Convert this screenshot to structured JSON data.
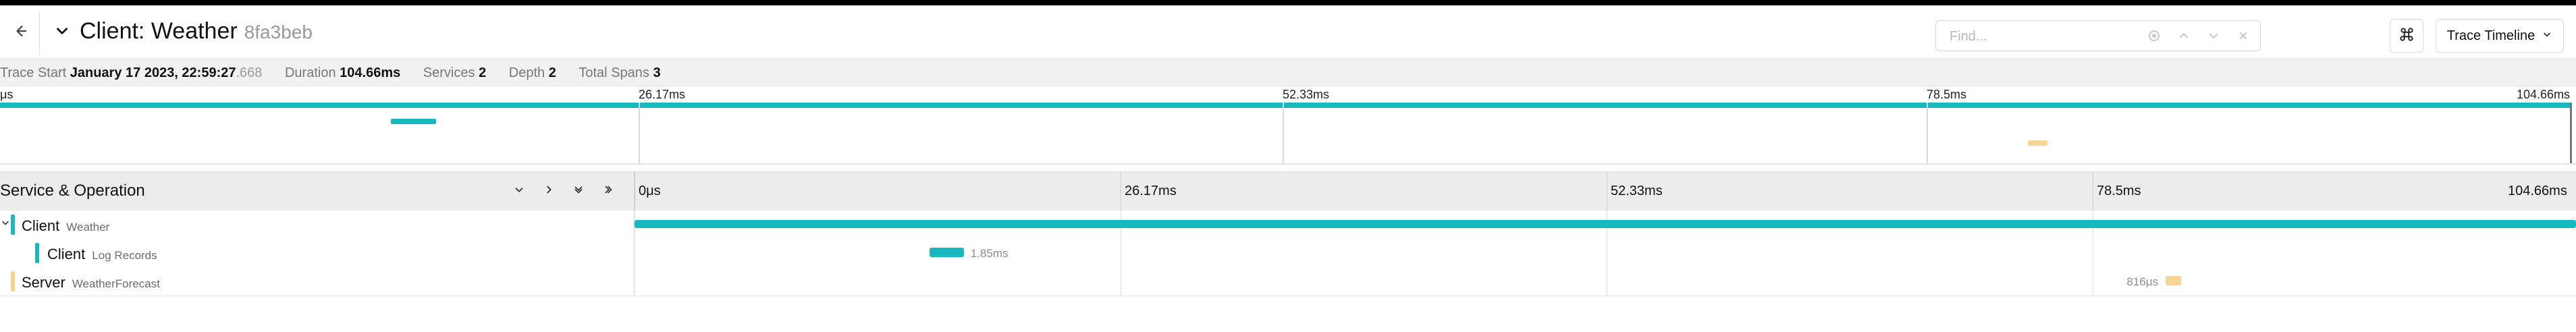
{
  "colors": {
    "teal": "#17b8be",
    "amber": "#f7d08a",
    "grid": "#d7d7d7"
  },
  "header": {
    "back_icon": "arrow-left-icon",
    "collapse_icon": "chevron-down-icon",
    "title": "Client: Weather",
    "trace_id": "8fa3beb",
    "find_placeholder": "Find...",
    "find_icons": [
      "target-icon",
      "chevron-up-icon",
      "chevron-down-icon",
      "close-icon"
    ],
    "command_icon": "command-icon",
    "view_label": "Trace Timeline"
  },
  "summary": {
    "trace_start_label": "Trace Start",
    "trace_start_value": "January 17 2023, 22:59:27",
    "trace_start_ms": ".668",
    "duration_label": "Duration",
    "duration_value": "104.66ms",
    "services_label": "Services",
    "services_value": "2",
    "depth_label": "Depth",
    "depth_value": "2",
    "total_spans_label": "Total Spans",
    "total_spans_value": "3"
  },
  "timeline": {
    "total_ms": 104.66,
    "ticks": [
      "μs",
      "26.17ms",
      "52.33ms",
      "78.5ms",
      "104.66ms"
    ],
    "table_ticks": [
      "0μs",
      "26.17ms",
      "52.33ms",
      "78.5ms",
      "104.66ms"
    ]
  },
  "table": {
    "column_title": "Service & Operation",
    "controls": [
      "chevron-down-icon",
      "chevron-right-icon",
      "double-chevron-down-icon",
      "double-chevron-right-icon"
    ]
  },
  "spans": [
    {
      "service": "Client",
      "operation": "Weather",
      "start_ms": 0.0,
      "duration_ms": 104.66,
      "duration_label": "",
      "color": "teal",
      "depth": 0
    },
    {
      "service": "Client",
      "operation": "Log Records",
      "start_ms": 15.9,
      "duration_ms": 1.85,
      "duration_label": "1.85ms",
      "color": "teal",
      "depth": 1
    },
    {
      "service": "Server",
      "operation": "WeatherForecast",
      "start_ms": 82.55,
      "duration_ms": 0.816,
      "duration_label": "816μs",
      "color": "amber",
      "depth": 0
    }
  ]
}
